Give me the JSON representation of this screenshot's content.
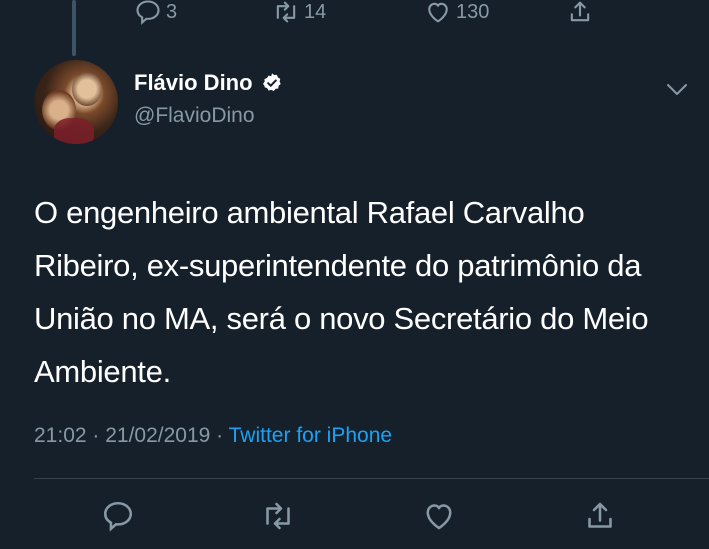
{
  "previous_tweet": {
    "reply_count": "3",
    "retweet_count": "14",
    "like_count": "130"
  },
  "author": {
    "display_name": "Flávio Dino",
    "handle": "@FlavioDino",
    "verified": true
  },
  "tweet": {
    "text": "O engenheiro ambiental Rafael Carvalho Ribeiro, ex-superintendente do patrimônio da União no MA, será o novo Secretário do Meio Ambiente.",
    "time": "21:02",
    "separator1": " · ",
    "date": "21/02/2019",
    "separator2": " · ",
    "source": "Twitter for iPhone"
  },
  "icons": {
    "reply": "reply-icon",
    "retweet": "retweet-icon",
    "like": "heart-icon",
    "share": "share-icon",
    "more": "chevron-down-icon",
    "verified": "verified-badge-icon"
  },
  "colors": {
    "background": "#15202b",
    "secondary_text": "#8899a6",
    "link": "#1da1f2",
    "divider": "#38444d"
  }
}
